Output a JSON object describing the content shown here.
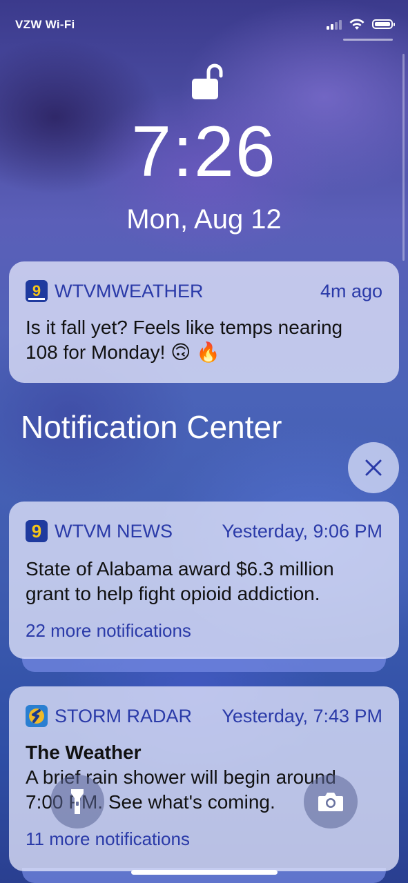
{
  "status_bar": {
    "carrier": "VZW Wi-Fi",
    "icons": [
      "signal-icon",
      "wifi-icon",
      "battery-icon"
    ]
  },
  "lock_screen": {
    "lock_icon": "unlocked-padlock-icon",
    "time": "7:26",
    "date": "Mon, Aug 12"
  },
  "notification_wtvmweather": {
    "app": "WTVMWEATHER",
    "icon": "wtvm-storm-team-icon",
    "time": "4m ago",
    "body_line1": "Is it fall yet? Feels like temps nearing",
    "body_line2": "108 for Monday! 🙃 🔥"
  },
  "notification_center": {
    "title": "Notification Center",
    "clear_icon": "close-icon"
  },
  "notification_wtvmnews": {
    "app": "WTVM NEWS",
    "icon": "wtvm-news-icon",
    "time": "Yesterday, 9:06 PM",
    "body_line1": "State of Alabama award $6.3 million",
    "body_line2": "grant to help fight opioid addiction.",
    "more": "22 more notifications"
  },
  "notification_stormradar": {
    "app": "STORM RADAR",
    "icon": "storm-radar-icon",
    "time": "Yesterday, 7:43 PM",
    "title": "The Weather",
    "body_line1": "A brief rain shower will begin around",
    "body_line2": "7:00 PM. See what's coming.",
    "more": "11 more notifications"
  },
  "quick_actions": {
    "flashlight_icon": "flashlight-icon",
    "camera_icon": "camera-icon"
  },
  "colors": {
    "accent": "#2a3aa8",
    "wtvm_yellow": "#f5c518",
    "wtvm_blue": "#1f3a9e"
  }
}
